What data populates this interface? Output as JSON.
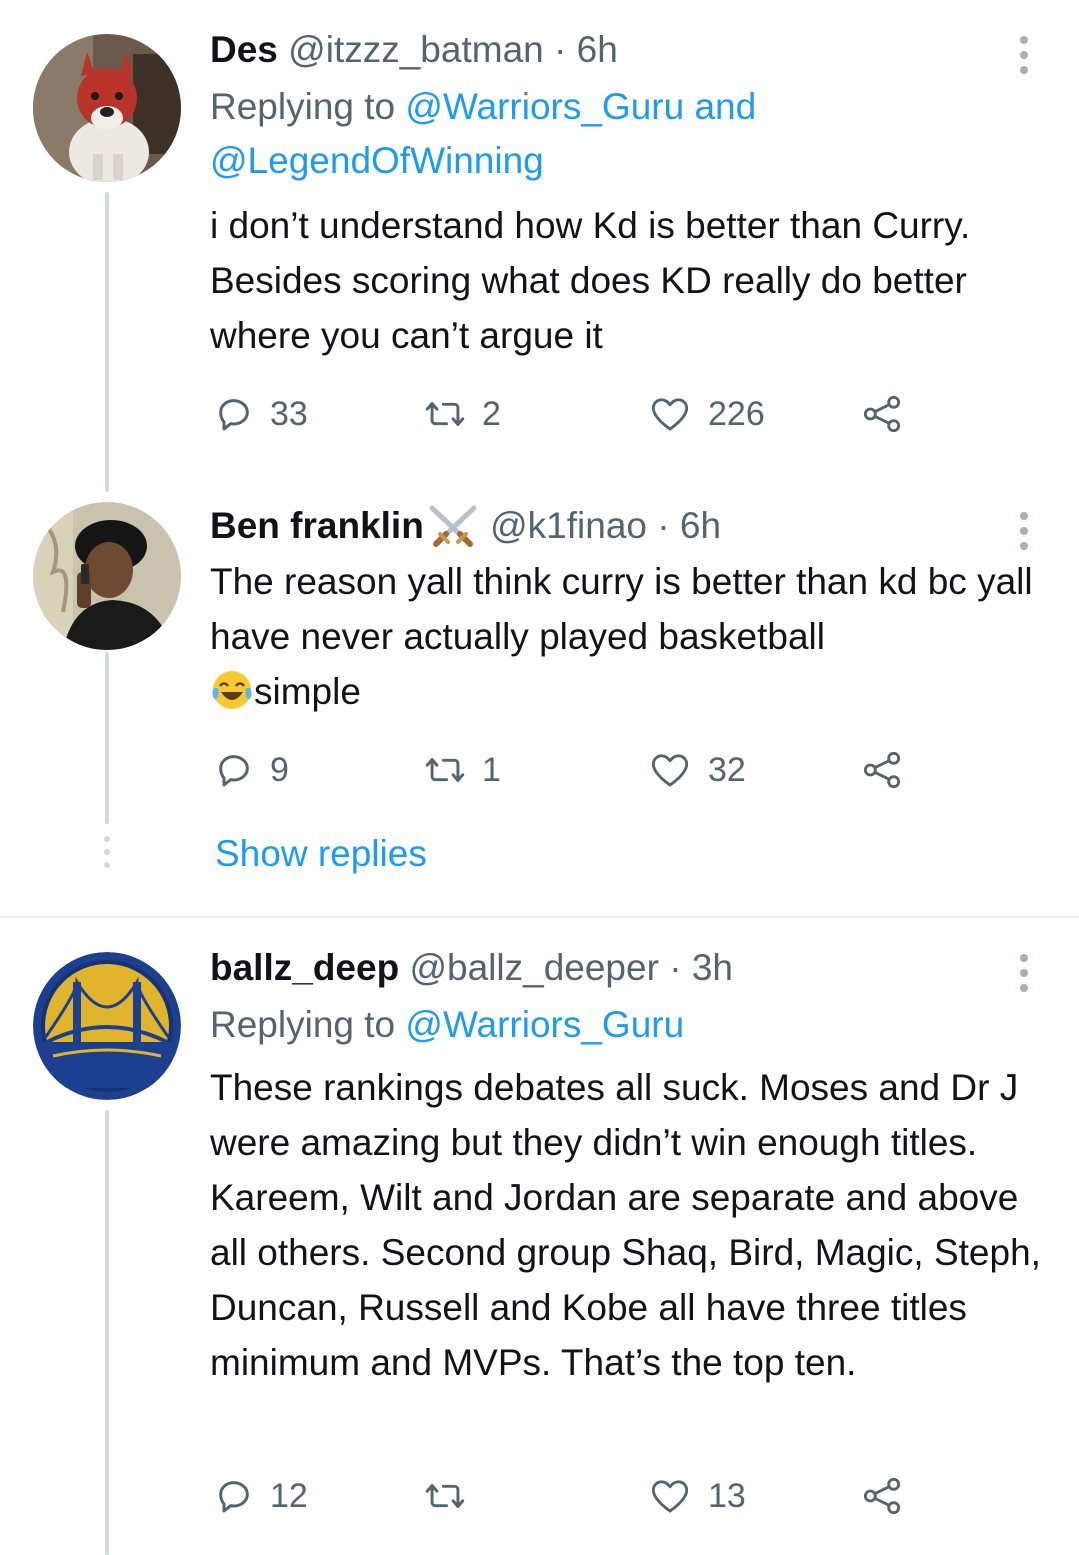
{
  "tweets": [
    {
      "name": "Des",
      "handle": "@itzzz_batman",
      "time": "6h",
      "replying_prefix": "Replying to",
      "replying_link1": "@Warriors_Guru",
      "replying_and": "and",
      "replying_link2": "@LegendOfWinning",
      "text": "i don’t understand how Kd is better than Curry. Besides scoring what does KD really do better where you can’t argue it",
      "replies": "33",
      "retweets": "2",
      "likes": "226"
    },
    {
      "name": "Ben franklin",
      "handle": "@k1finao",
      "time": "6h",
      "text": "The reason yall think curry is better than kd bc yall have never actually played basketball",
      "text_emoji_after": "simple",
      "replies": "9",
      "retweets": "1",
      "likes": "32"
    },
    {
      "name": "ballz_deep",
      "handle": "@ballz_deeper",
      "time": "3h",
      "replying_prefix": "Replying to",
      "replying_link1": "@Warriors_Guru",
      "text": "These rankings debates all suck. Moses and Dr J were amazing but they didn’t win enough titles. Kareem, Wilt and Jordan are separate and above all others. Second group Shaq, Bird, Magic, Steph, Duncan, Russell and Kobe all have three titles minimum and MVPs. That’s the top ten.",
      "replies": "12",
      "retweets": "",
      "likes": "13"
    }
  ],
  "show_replies_label": "Show replies",
  "separator": "·",
  "colors": {
    "link": "#1d9bf0",
    "muted": "#536471",
    "text": "#0f1419",
    "line": "#cfd9de"
  }
}
